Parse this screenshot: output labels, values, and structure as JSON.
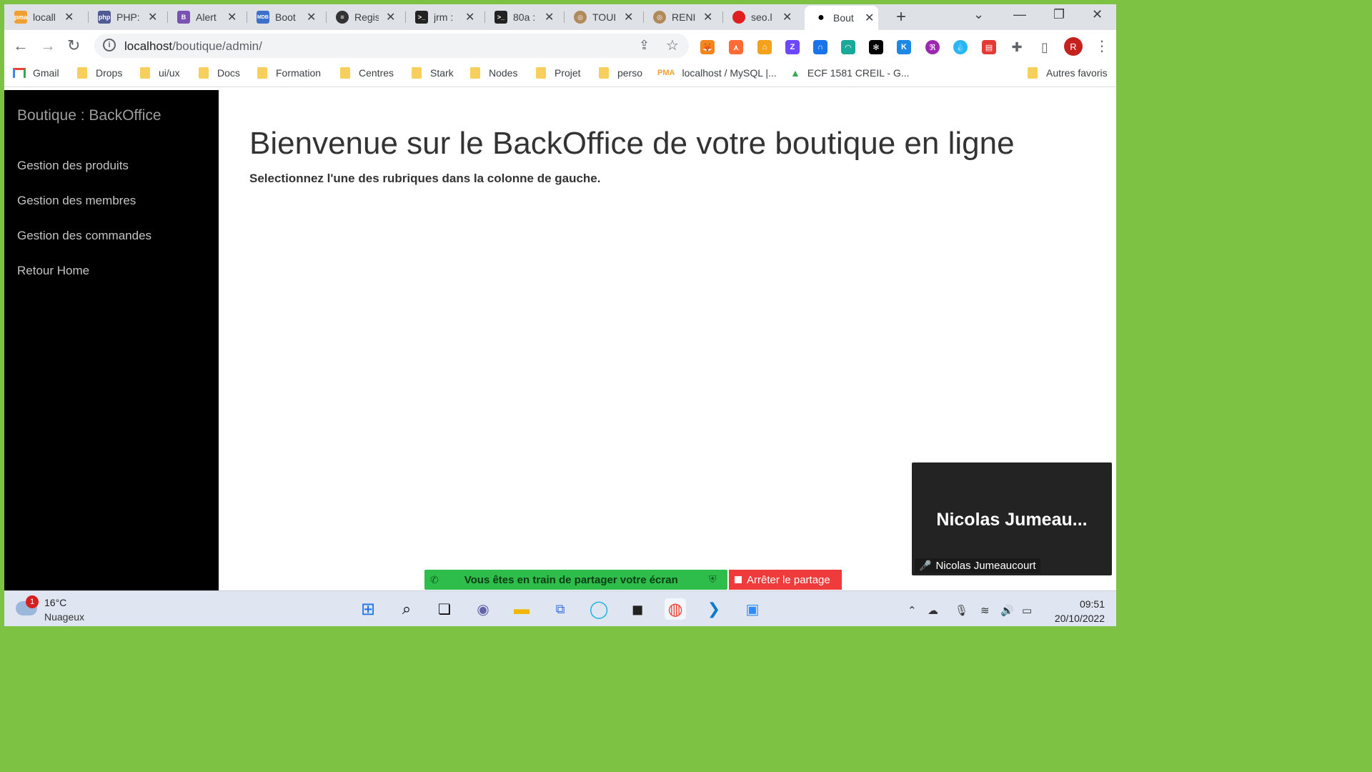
{
  "tabs": [
    {
      "title": "locall",
      "icon": "phpmyadmin-icon",
      "color": "#f0a030",
      "glyph": "pma"
    },
    {
      "title": "PHP:",
      "icon": "php-icon",
      "color": "#4f5b93",
      "glyph": "php"
    },
    {
      "title": "Alert",
      "icon": "bootstrap-icon",
      "color": "#7952b3",
      "glyph": "B"
    },
    {
      "title": "Boot",
      "icon": "mdb-icon",
      "color": "#3b71ca",
      "glyph": "MDB"
    },
    {
      "title": "Regis",
      "icon": "globe-lines-icon",
      "color": "#333333",
      "glyph": "≡"
    },
    {
      "title": "jrm :",
      "icon": "terminal-icon",
      "color": "#222222",
      "glyph": ">_"
    },
    {
      "title": "80a :",
      "icon": "terminal-icon",
      "color": "#222222",
      "glyph": ">_"
    },
    {
      "title": "TOUI",
      "icon": "coin-icon",
      "color": "#b08a5a",
      "glyph": "◎"
    },
    {
      "title": "RENI",
      "icon": "coin-icon",
      "color": "#b08a5a",
      "glyph": "◎"
    },
    {
      "title": "seo.l",
      "icon": "red-dot-icon",
      "color": "#e02020",
      "glyph": ""
    },
    {
      "title": "Bout",
      "icon": "apple-icon",
      "color": "#000000",
      "glyph": ""
    }
  ],
  "address": {
    "host": "localhost",
    "path": "/boutique/admin/"
  },
  "bookmarks": [
    {
      "label": "Gmail",
      "type": "gmail"
    },
    {
      "label": "Drops",
      "type": "folder"
    },
    {
      "label": "ui/ux",
      "type": "folder"
    },
    {
      "label": "Docs",
      "type": "folder"
    },
    {
      "label": "Formation",
      "type": "folder"
    },
    {
      "label": "Centres",
      "type": "folder"
    },
    {
      "label": "Stark",
      "type": "folder"
    },
    {
      "label": "Nodes",
      "type": "folder"
    },
    {
      "label": "Projet",
      "type": "folder"
    },
    {
      "label": "perso",
      "type": "folder"
    },
    {
      "label": "localhost / MySQL |...",
      "type": "pma"
    },
    {
      "label": "ECF 1581 CREIL - G...",
      "type": "drive"
    },
    {
      "label": "Autres favoris",
      "type": "folder"
    }
  ],
  "profile_initial": "R",
  "sidebar": {
    "brand": "Boutique : BackOffice",
    "links": [
      "Gestion des produits",
      "Gestion des membres",
      "Gestion des commandes",
      "Retour Home"
    ]
  },
  "main": {
    "title": "Bienvenue sur le BackOffice de votre boutique en ligne",
    "subtitle": "Selectionnez l'une des rubriques dans la colonne de gauche."
  },
  "share": {
    "message": "Vous êtes en train de partager votre écran",
    "stop_label": "Arrêter le partage"
  },
  "video": {
    "big_name": "Nicolas  Jumeau...",
    "participant": "Nicolas Jumeaucourt"
  },
  "taskbar": {
    "weather_badge": "1",
    "temperature": "16°C",
    "condition": "Nuageux",
    "time": "09:51",
    "date": "20/10/2022"
  },
  "colors": {
    "sidebar_bg": "#000000",
    "share_green": "#2ebd4a",
    "stop_red": "#ef3b3b",
    "desktop_border": "#7dc243"
  }
}
